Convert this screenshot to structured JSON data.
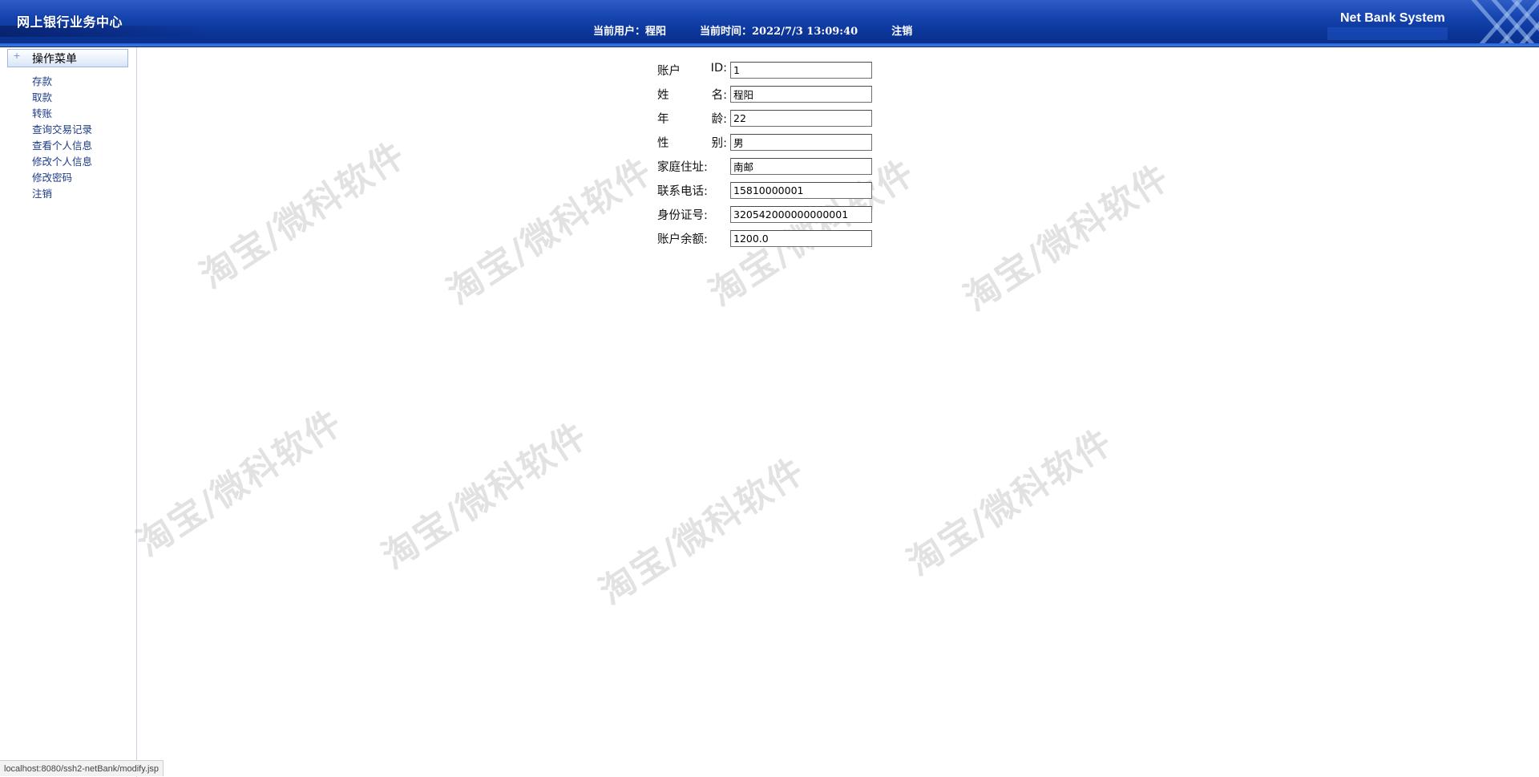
{
  "header": {
    "app_title": "网上银行业务中心",
    "current_user": "当前用户：程阳",
    "current_time": "当前时间：2022/7/3 13:09:40",
    "logout": "注销",
    "brand": "Net Bank System"
  },
  "sidebar": {
    "menu_title": "操作菜单",
    "items": [
      {
        "label": "存款"
      },
      {
        "label": "取款"
      },
      {
        "label": "转账"
      },
      {
        "label": "查询交易记录"
      },
      {
        "label": "查看个人信息"
      },
      {
        "label": "修改个人信息"
      },
      {
        "label": "修改密码"
      },
      {
        "label": "注销"
      }
    ]
  },
  "form": {
    "fields": [
      {
        "label_a": "账户",
        "label_b": "ID:",
        "value": "1"
      },
      {
        "label_a": "姓",
        "label_b": "名:",
        "value": "程阳"
      },
      {
        "label_a": "年",
        "label_b": "龄:",
        "value": "22"
      },
      {
        "label_a": "性",
        "label_b": "别:",
        "value": "男"
      },
      {
        "label_a": "家庭住址:",
        "label_b": "",
        "value": "南邮"
      },
      {
        "label_a": "联系电话:",
        "label_b": "",
        "value": "15810000001"
      },
      {
        "label_a": "身份证号:",
        "label_b": "",
        "value": "320542000000000001"
      },
      {
        "label_a": "账户余额:",
        "label_b": "",
        "value": "1200.0"
      }
    ]
  },
  "watermark_text": "淘宝/微科软件",
  "status_url": "localhost:8080/ssh2-netBank/modify.jsp",
  "colors": {
    "header_blue": "#0b3599",
    "menu_link": "#1c3a8a"
  }
}
